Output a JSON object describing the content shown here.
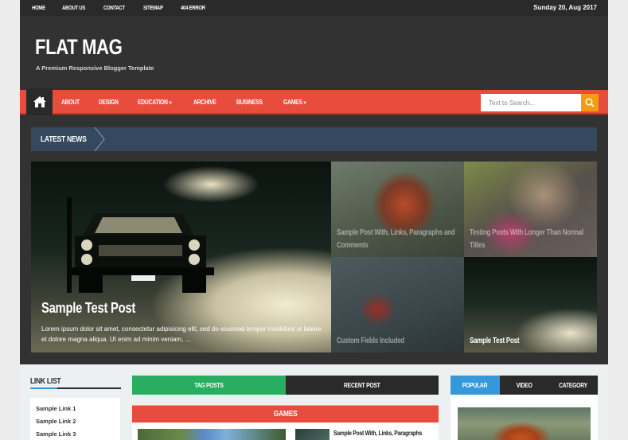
{
  "topbar": {
    "links": [
      "HOME",
      "ABOUT US",
      "CONTACT",
      "SITEMAP",
      "404 ERROR"
    ],
    "date": "Sunday 20, Aug 2017"
  },
  "header": {
    "logo": "FLAT MAG",
    "tagline": "A Premium Responsive Blogger Template"
  },
  "nav": {
    "home_icon": "home-icon",
    "links": [
      "ABOUT",
      "DESIGN",
      "EDUCATION »",
      "ARCHIVE",
      "BUSINESS",
      "GAMES »"
    ],
    "search_placeholder": "Text to Search...",
    "search_icon": "search-icon"
  },
  "latest_news": {
    "label": "LATEST NEWS"
  },
  "featured": {
    "main": {
      "title": "Sample Test Post",
      "excerpt": "Lorem ipsum dolor sit amet, consectetur adipisicing elit, sed do eiusmod tempor incididunt ut labore et dolore magna aliqua. Ut enim ad minim veniam, ..."
    },
    "small": [
      {
        "title": "Sample Post With, Links, Paragraphs and Comments"
      },
      {
        "title": "Testing Posts With Longer Than Normal Titles"
      },
      {
        "title": "Custom Fields Included"
      },
      {
        "title": "Sample Test Post"
      }
    ]
  },
  "link_list": {
    "title": "LINK LIST",
    "links": [
      "Sample Link 1",
      "Sample Link 2",
      "Sample Link 3"
    ]
  },
  "middle_tabs": [
    "TAG POSTS",
    "RECENT POST"
  ],
  "games": {
    "title": "GAMES",
    "post_title": "Sample Post With, Links, Paragraphs"
  },
  "right_tabs": [
    "POPULAR",
    "VIDEO",
    "CATEGORY"
  ],
  "colors": {
    "nav_red": "#e84c3d",
    "dark": "#323232",
    "latest_blue": "#34495e",
    "search_orange": "#f39c12",
    "tab_green": "#27ae60",
    "tab_blue": "#3498db"
  }
}
